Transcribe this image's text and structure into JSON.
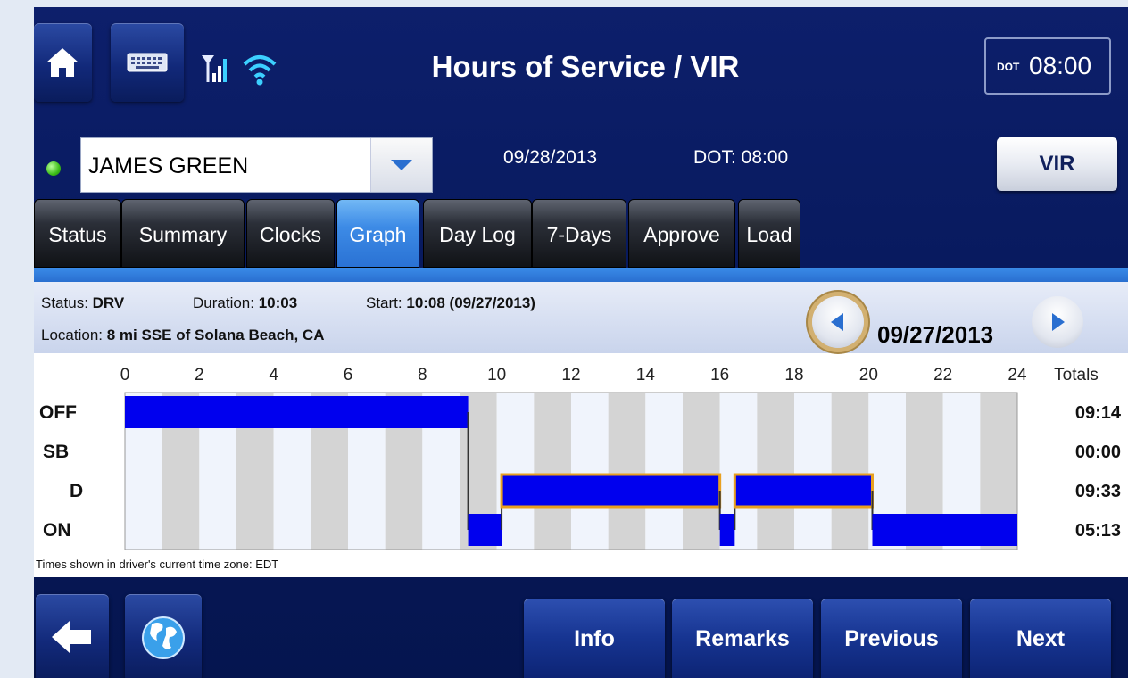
{
  "header": {
    "title": "Hours of Service / VIR",
    "dot_clock_label": "DOT",
    "dot_clock_value": "08:00",
    "icons": [
      "home-icon",
      "keyboard-icon",
      "signal-icon",
      "wifi-icon"
    ]
  },
  "driver": {
    "name": "JAMES GREEN",
    "status_color": "#3cbd18",
    "date": "09/28/2013",
    "dot_time": "DOT: 08:00"
  },
  "vir_label": "VIR",
  "tabs": [
    {
      "label": "Status"
    },
    {
      "label": "Summary"
    },
    {
      "label": "Clocks"
    },
    {
      "label": "Graph",
      "active": true
    },
    {
      "label": "Day Log"
    },
    {
      "label": "7-Days"
    },
    {
      "label": "Approve"
    },
    {
      "label": "Load"
    }
  ],
  "info": {
    "status_label": "Status:",
    "status_value": "DRV",
    "duration_label": "Duration:",
    "duration_value": "10:03",
    "start_label": "Start:",
    "start_value": "10:08 (09/27/2013)",
    "location_label": "Location:",
    "location_value": "8 mi SSE of Solana Beach, CA",
    "nav_date": "09/27/2013"
  },
  "timezone_note": "Times shown in driver's current time zone: EDT",
  "chart_data": {
    "type": "duty-status-grid",
    "x_ticks": [
      "0",
      "2",
      "4",
      "6",
      "8",
      "10",
      "12",
      "14",
      "16",
      "18",
      "20",
      "22",
      "24"
    ],
    "xlim": [
      0,
      24
    ],
    "rows": [
      "OFF",
      "SB",
      "D",
      "ON"
    ],
    "totals_header": "Totals",
    "totals": [
      "09:14",
      "00:00",
      "09:33",
      "05:13"
    ],
    "segments": [
      {
        "status": "OFF",
        "start": 0,
        "end": 9.23
      },
      {
        "status": "ON",
        "start": 9.23,
        "end": 10.13
      },
      {
        "status": "D",
        "start": 10.13,
        "end": 16.0,
        "highlighted": true
      },
      {
        "status": "ON",
        "start": 16.0,
        "end": 16.4
      },
      {
        "status": "D",
        "start": 16.4,
        "end": 20.1,
        "highlighted": true
      },
      {
        "status": "ON",
        "start": 20.1,
        "end": 24.0
      }
    ],
    "colors": {
      "segment": "#0000ee",
      "highlight": "#e8a020",
      "grid_dark": "#d4d4d4",
      "grid_light": "#f0f4fc"
    }
  },
  "footer": {
    "buttons": [
      "Info",
      "Remarks",
      "Previous",
      "Next"
    ],
    "icons": [
      "back-arrow-icon",
      "globe-icon"
    ]
  }
}
